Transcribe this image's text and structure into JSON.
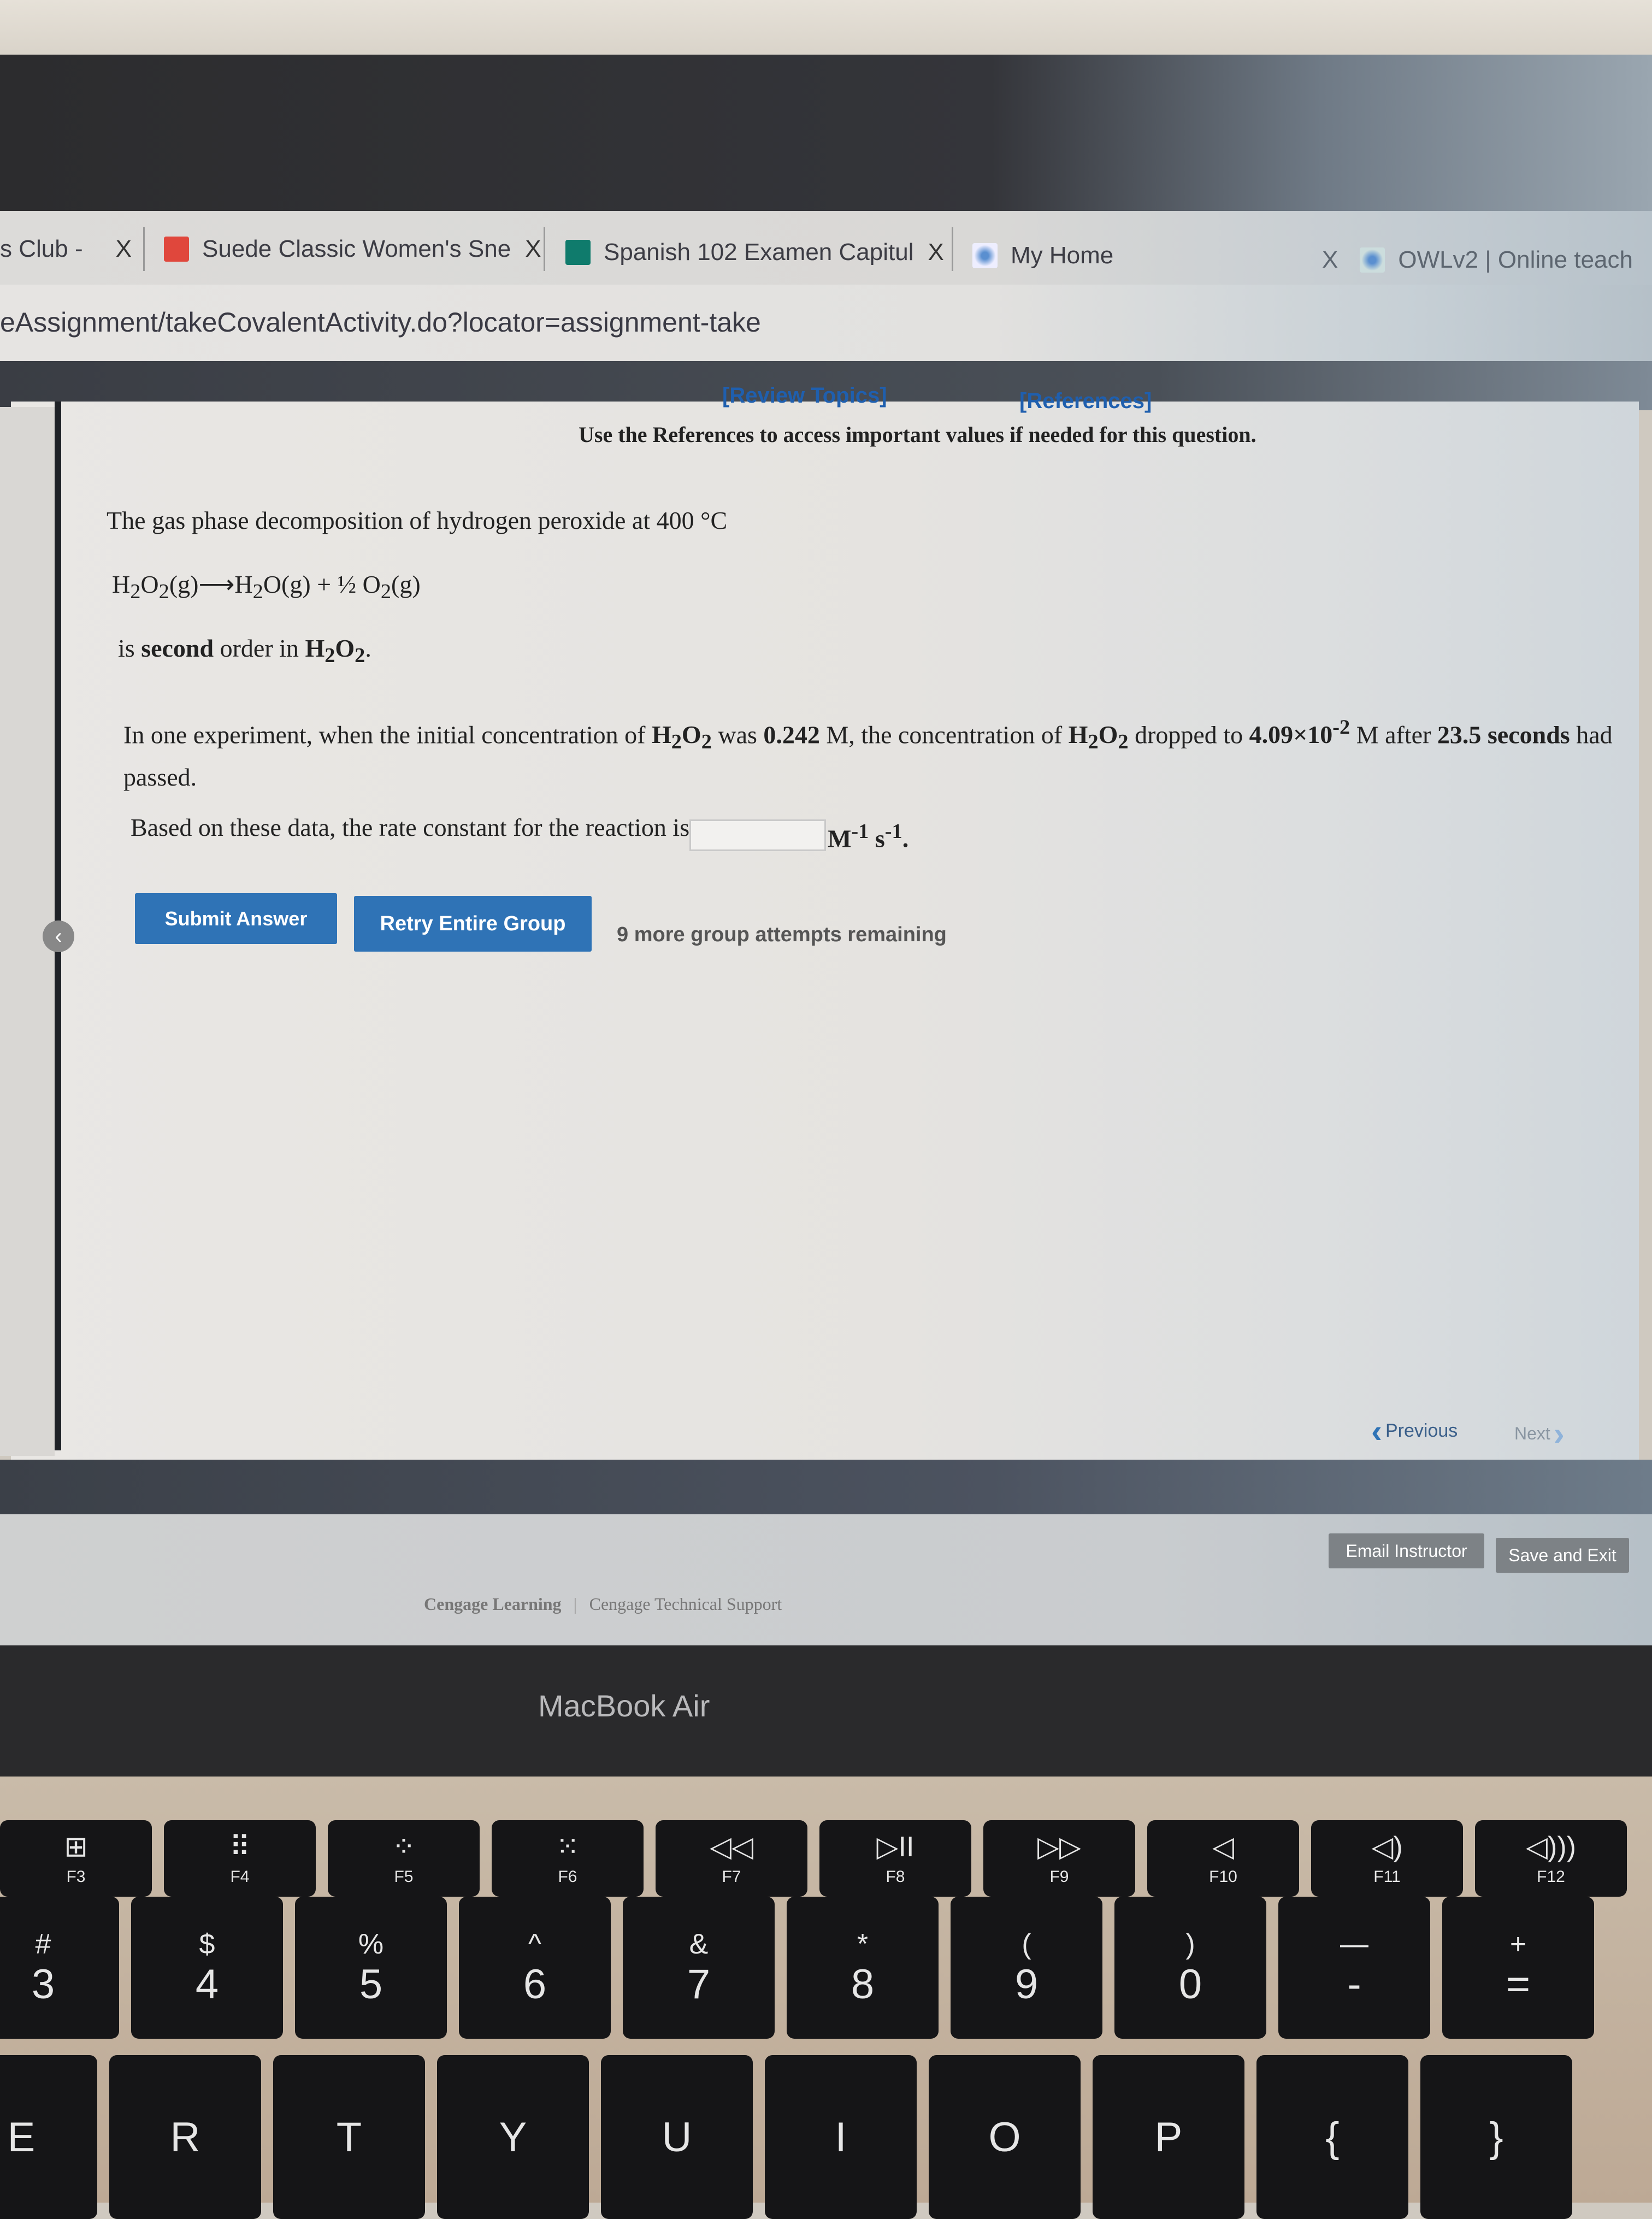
{
  "browser": {
    "tabs": [
      {
        "label": "s Club -",
        "icon": "tab-icon",
        "close": "X"
      },
      {
        "label": "Suede Classic Women's Sne",
        "icon": "puma-icon",
        "close": "X",
        "icon_color": "#e0473c"
      },
      {
        "label": "Spanish 102 Examen Capitul",
        "icon": "forms-icon",
        "close": "X",
        "icon_color": "#0f7b6c"
      },
      {
        "label": "My Home",
        "icon": "owl-icon"
      },
      {
        "label": "OWLv2 | Online teach",
        "icon": "owl-icon",
        "close": "X"
      }
    ],
    "url": "eAssignment/takeCovalentActivity.do?locator=assignment-take"
  },
  "header": {
    "review_topics": "[Review Topics]",
    "references": "[References]",
    "note": "Use the References to access important values if needed for this question."
  },
  "question": {
    "intro": "The gas phase decomposition of hydrogen peroxide at 400 °C",
    "equation": {
      "reactant": "H",
      "r2": "O",
      "r3": "(g)",
      "arrow": "⟶",
      "p1": "H",
      "p1b": "O(g) + ½ O",
      "p1c": "(g)",
      "sub": "2"
    },
    "order_pre": "is ",
    "order_bold": "second",
    "order_mid": " order in ",
    "order_species": "H",
    "order_end": ".",
    "experiment": {
      "t1": "In one experiment, when the initial concentration of ",
      "s1": "H",
      "t2": " was ",
      "c0": "0.242",
      "t3": " M, the concentration of ",
      "t4": " dropped to ",
      "c1": "4.09×10",
      "exp": "-2",
      "t5": " M after ",
      "time": "23.5 seconds",
      "t6": " had passed."
    },
    "prompt": "Based on these data, the rate constant for the reaction is",
    "answer_value": "",
    "units": "M",
    "u_exp1": "-1",
    "s": "s",
    "u_exp2": "-1",
    "period": "."
  },
  "actions": {
    "submit": "Submit Answer",
    "retry": "Retry Entire Group",
    "attempts": "9 more group attempts remaining"
  },
  "nav": {
    "previous": "Previous",
    "next": "Next",
    "email": "Email Instructor",
    "save_exit": "Save and Exit"
  },
  "footer": {
    "cengage": "Cengage Learning",
    "divider": "|",
    "support": "Cengage Technical Support"
  },
  "device": {
    "label": "MacBook Air"
  },
  "keyboard": {
    "fn_row": [
      {
        "icon": "mission-control-icon",
        "sym": "⊞",
        "label": "F3"
      },
      {
        "icon": "launchpad-icon",
        "sym": "⠿",
        "label": "F4"
      },
      {
        "icon": "keyboard-brightness-down-icon",
        "sym": "⁘",
        "label": "F5"
      },
      {
        "icon": "keyboard-brightness-up-icon",
        "sym": "⁙",
        "label": "F6"
      },
      {
        "icon": "rewind-icon",
        "sym": "◁◁",
        "label": "F7"
      },
      {
        "icon": "play-pause-icon",
        "sym": "▷II",
        "label": "F8"
      },
      {
        "icon": "fast-forward-icon",
        "sym": "▷▷",
        "label": "F9"
      },
      {
        "icon": "mute-icon",
        "sym": "◁",
        "label": "F10"
      },
      {
        "icon": "volume-down-icon",
        "sym": "◁)",
        "label": "F11"
      },
      {
        "icon": "volume-up-icon",
        "sym": "◁)))",
        "label": "F12"
      }
    ],
    "num_row": [
      {
        "top": "#",
        "main": "3"
      },
      {
        "top": "$",
        "main": "4"
      },
      {
        "top": "%",
        "main": "5"
      },
      {
        "top": "^",
        "main": "6"
      },
      {
        "top": "&",
        "main": "7"
      },
      {
        "top": "*",
        "main": "8"
      },
      {
        "top": "(",
        "main": "9"
      },
      {
        "top": ")",
        "main": "0"
      },
      {
        "top": "—",
        "main": "-"
      },
      {
        "top": "+",
        "main": "="
      }
    ],
    "letter_row": [
      "E",
      "R",
      "T",
      "Y",
      "U",
      "I",
      "O",
      "P",
      "{",
      "}"
    ]
  }
}
